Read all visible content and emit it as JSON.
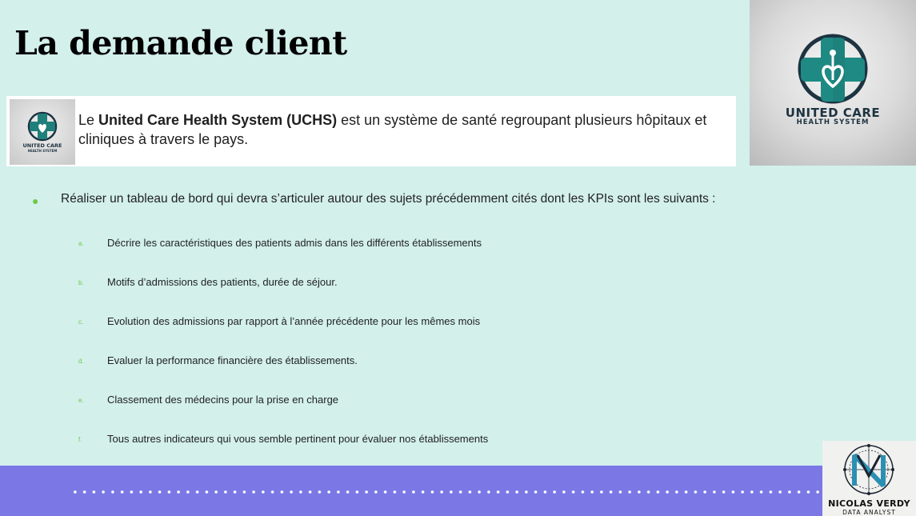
{
  "slide": {
    "title": "La demande client"
  },
  "intro": {
    "prefix": "Le ",
    "org_name": "United Care Health System (UCHS)",
    "suffix": " est un système de santé regroupant plusieurs hôpitaux et cliniques à travers le pays."
  },
  "brand": {
    "name_line1": "UNITED CARE",
    "name_line2": "HEALTH SYSTEM",
    "primary_color": "#1f7f7a",
    "dark_color": "#1d3340"
  },
  "main_bullet": "Réaliser un tableau de bord qui devra s’articuler autour des sujets précédemment cités dont les KPIs sont les suivants :",
  "kpis": [
    {
      "marker": "a.",
      "text": "Décrire les caractéristiques des patients admis dans les différents établissements"
    },
    {
      "marker": "b.",
      "text": "Motifs d’admissions des patients, durée de séjour."
    },
    {
      "marker": "c.",
      "text": "Evolution des admissions par rapport à l’année précédente pour les mêmes mois"
    },
    {
      "marker": "d.",
      "text": "Evaluer la performance financière des établissements."
    },
    {
      "marker": "e.",
      "text": "Classement des médecins pour la prise en charge"
    },
    {
      "marker": "f.",
      "text": "Tous autres indicateurs qui vous semble pertinent pour évaluer nos établissements"
    }
  ],
  "signature": {
    "name": "NICOLAS VERDY",
    "role": "DATA ANALYST"
  },
  "colors": {
    "background": "#d3f0eb",
    "footer": "#7b78e6",
    "bullet": "#6cc94a"
  }
}
